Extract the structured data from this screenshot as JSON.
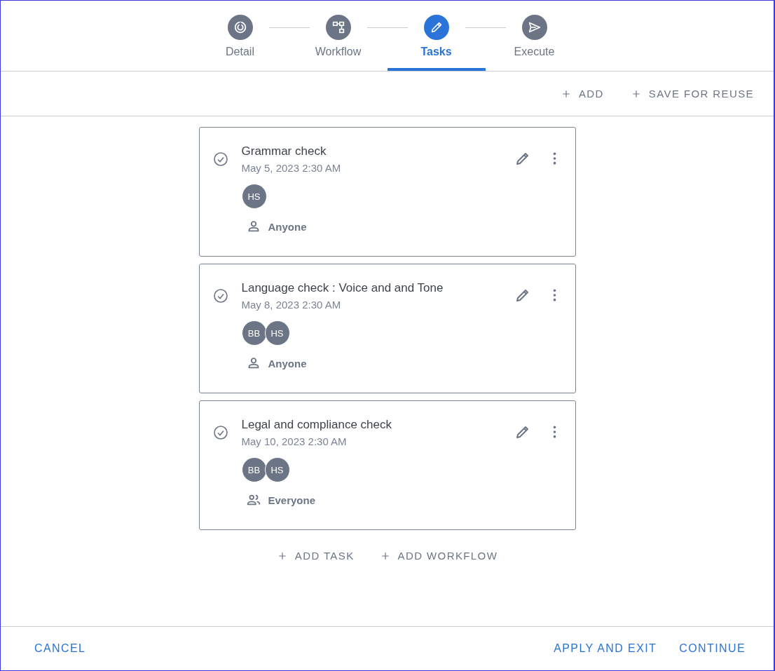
{
  "steps": [
    {
      "label": "Detail",
      "kind": "target",
      "selected": false
    },
    {
      "label": "Workflow",
      "kind": "flow",
      "selected": false
    },
    {
      "label": "Tasks",
      "kind": "pencil",
      "selected": true
    },
    {
      "label": "Execute",
      "kind": "send",
      "selected": false
    }
  ],
  "toolbar": [
    {
      "label": "ADD"
    },
    {
      "label": "SAVE FOR REUSE"
    }
  ],
  "tasks": [
    {
      "title": "Grammar check",
      "date": "May 5, 2023 2:30 AM",
      "avatars": [
        "HS"
      ],
      "assignee": {
        "kind": "person",
        "label": "Anyone"
      }
    },
    {
      "title": "Language check : Voice and and Tone",
      "date": "May 8, 2023 2:30 AM",
      "avatars": [
        "BB",
        "HS"
      ],
      "assignee": {
        "kind": "person",
        "label": "Anyone"
      }
    },
    {
      "title": "Legal and compliance check",
      "date": "May 10, 2023 2:30 AM",
      "avatars": [
        "BB",
        "HS"
      ],
      "assignee": {
        "kind": "group",
        "label": "Everyone"
      }
    }
  ],
  "add_actions": [
    {
      "label": "ADD TASK"
    },
    {
      "label": "ADD WORKFLOW"
    }
  ],
  "footer": {
    "left": "CANCEL",
    "right": [
      "APPLY AND EXIT",
      "CONTINUE"
    ]
  }
}
